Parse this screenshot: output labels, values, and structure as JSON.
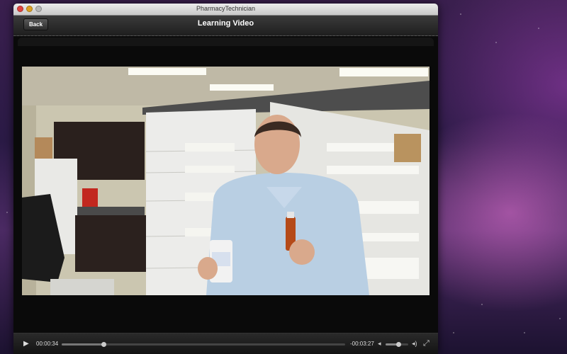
{
  "window": {
    "title": "PharmacyTechnician"
  },
  "navbar": {
    "back_label": "Back",
    "title": "Learning Video"
  },
  "player": {
    "elapsed": "00:00:34",
    "remaining": "-00:03:27",
    "progress_fraction": 0.148,
    "volume_fraction": 0.55
  },
  "icons": {
    "play": "play-icon",
    "volume_low": "volume-low-icon",
    "volume_high": "volume-high-icon",
    "fullscreen": "fullscreen-icon"
  },
  "colors": {
    "close": "#e0443e",
    "minimize": "#dea123",
    "navbar": "#2c2c2c"
  }
}
